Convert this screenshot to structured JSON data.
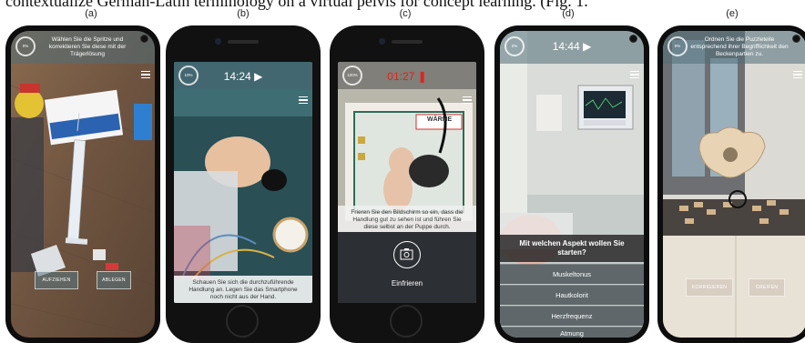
{
  "caption": "contextualize German-Latin terminology on a virtual pelvis for concept learning. (Fig. 1.",
  "panels": [
    {
      "label": "(a)",
      "instruction": "Wählen Sie die Spritze und korrektieren Sie diese mit der Trägerlösung",
      "progress": "0%",
      "buttons": [
        "AUFZIEHEN",
        "ABLEGEN"
      ]
    },
    {
      "label": "(b)",
      "time": "14:24",
      "progress": "10%",
      "bottom_text": "Schauen Sie sich die durchzuführende Handlung an. Legen Sie das Smartphone noch nicht aus der Hand."
    },
    {
      "label": "(c)",
      "time": "01:27",
      "progress": "100%",
      "overlay_text": "Frieren Sie den Bildschirm so ein, dass die Handlung gut zu sehen ist und führen Sie diese selbst an der Puppe durch.",
      "freeze_label": "Einfrieren",
      "sign_text": "WÄRME"
    },
    {
      "label": "(d)",
      "time": "14:44",
      "progress": "0%",
      "question": "Mit welchen Aspekt wollen Sie starten?",
      "choices": [
        "Muskeltonus",
        "Hautkolorit",
        "Herzfrequenz",
        "Atmung"
      ]
    },
    {
      "label": "(e)",
      "instruction": "Ordnen Sie die Puzzleteile entsprechend ihrer Begrifflichkeit den Beckenpartien zu.",
      "progress": "0%",
      "buttons": [
        "KORRIGIEREN",
        "GREIFEN"
      ]
    }
  ],
  "colors": {
    "ar_bar": "#506e78",
    "timer_red": "#e0231c",
    "question_bg": "#282828"
  }
}
